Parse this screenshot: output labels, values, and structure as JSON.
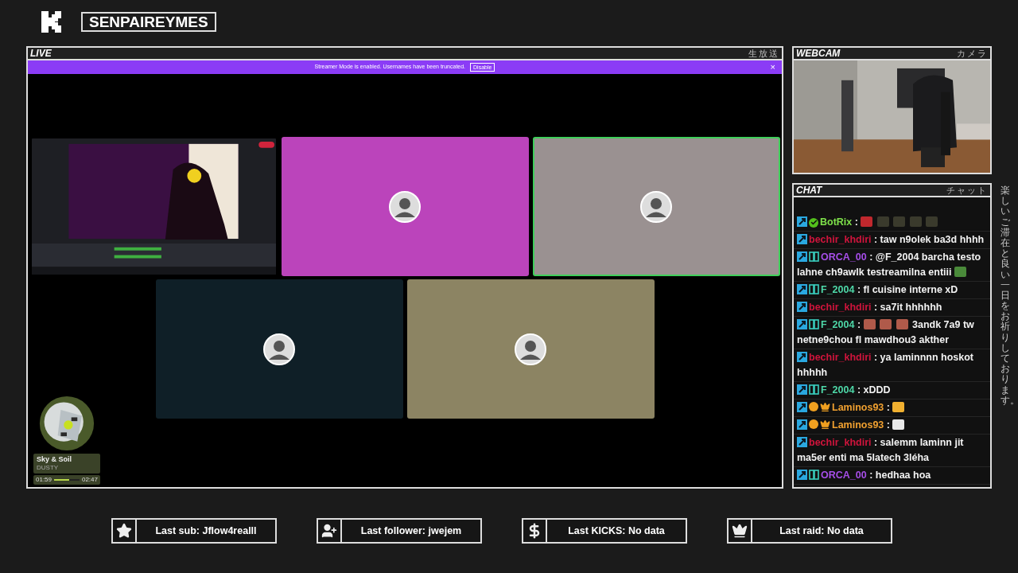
{
  "header": {
    "channel_name": "SENPAIREYMES"
  },
  "live": {
    "title": "LIVE",
    "subtitle": "生放送",
    "banner": {
      "text": "Streamer Mode is enabled. Usernames have been truncated.",
      "button": "Disable",
      "close": "×"
    },
    "tiles": [
      {
        "kind": "screen",
        "speaking": false
      },
      {
        "kind": "avatar",
        "color": "#bb44bb",
        "speaking": false
      },
      {
        "kind": "avatar",
        "color": "#9a9191",
        "speaking": true
      },
      {
        "kind": "avatar",
        "color": "#0f1f27",
        "speaking": false
      },
      {
        "kind": "avatar",
        "color": "#8c8463",
        "speaking": false
      }
    ],
    "music": {
      "title": "Sky & Soil",
      "artist": "DUSTY",
      "elapsed": "01:59",
      "total": "02:47",
      "level": 0.6
    }
  },
  "webcam": {
    "title": "WEBCAM",
    "subtitle": "カメラ"
  },
  "chat": {
    "title": "CHAT",
    "subtitle": "チャット",
    "messages": [
      {
        "user": "BotRix",
        "color": "#7ee04a",
        "badges": [
          {
            "kind": "kick"
          },
          {
            "kind": "verified"
          }
        ],
        "parts": [
          {
            "kind": "text",
            "text": ":"
          },
          {
            "kind": "emote",
            "color": "#c0282d"
          },
          {
            "kind": "emote",
            "color": "#3a3a2c"
          },
          {
            "kind": "emote",
            "color": "#3a3a2c"
          },
          {
            "kind": "emote",
            "color": "#3a3a2c"
          },
          {
            "kind": "emote",
            "color": "#3a3a2c"
          }
        ]
      },
      {
        "user": "bechir_khdiri",
        "color": "#d0143c",
        "badges": [
          {
            "kind": "kick"
          }
        ],
        "parts": [
          {
            "kind": "text",
            "text": ": taw n9olek ba3d hhhh"
          }
        ]
      },
      {
        "user": "ORCA_00",
        "color": "#a64ee8",
        "badges": [
          {
            "kind": "kick"
          },
          {
            "kind": "og"
          }
        ],
        "parts": [
          {
            "kind": "text",
            "text": ": @F_2004 barcha testo lahne ch9awlk testreamilna entiii"
          },
          {
            "kind": "emote",
            "color": "#4a8a3a"
          }
        ]
      },
      {
        "user": "F_2004",
        "color": "#4ed8a8",
        "badges": [
          {
            "kind": "kick"
          },
          {
            "kind": "og"
          }
        ],
        "parts": [
          {
            "kind": "text",
            "text": ": fl cuisine interne xD"
          }
        ]
      },
      {
        "user": "bechir_khdiri",
        "color": "#d0143c",
        "badges": [
          {
            "kind": "kick"
          }
        ],
        "parts": [
          {
            "kind": "text",
            "text": ": sa7it hhhhhh"
          }
        ]
      },
      {
        "user": "F_2004",
        "color": "#4ed8a8",
        "badges": [
          {
            "kind": "kick"
          },
          {
            "kind": "og"
          }
        ],
        "parts": [
          {
            "kind": "text",
            "text": ":"
          },
          {
            "kind": "emote",
            "color": "#b05a4a"
          },
          {
            "kind": "emote",
            "color": "#b05a4a"
          },
          {
            "kind": "emote",
            "color": "#b05a4a"
          },
          {
            "kind": "text",
            "text": "3andk 7a9 tw netne9chou fl mawdhou3 akther"
          }
        ]
      },
      {
        "user": "bechir_khdiri",
        "color": "#d0143c",
        "badges": [
          {
            "kind": "kick"
          }
        ],
        "parts": [
          {
            "kind": "text",
            "text": ": ya laminnnn hoskot hhhhh"
          }
        ]
      },
      {
        "user": "F_2004",
        "color": "#4ed8a8",
        "badges": [
          {
            "kind": "kick"
          },
          {
            "kind": "og"
          }
        ],
        "parts": [
          {
            "kind": "text",
            "text": ": xDDD"
          }
        ]
      },
      {
        "user": "Laminos93",
        "color": "#f0a030",
        "badges": [
          {
            "kind": "kick"
          },
          {
            "kind": "sub"
          },
          {
            "kind": "crown"
          }
        ],
        "parts": [
          {
            "kind": "text",
            "text": ":"
          },
          {
            "kind": "emote",
            "color": "#f0b030"
          }
        ]
      },
      {
        "user": "Laminos93",
        "color": "#f0a030",
        "badges": [
          {
            "kind": "kick"
          },
          {
            "kind": "sub"
          },
          {
            "kind": "crown"
          }
        ],
        "parts": [
          {
            "kind": "text",
            "text": ":"
          },
          {
            "kind": "emote",
            "color": "#e8e8e8"
          }
        ]
      },
      {
        "user": "bechir_khdiri",
        "color": "#d0143c",
        "badges": [
          {
            "kind": "kick"
          }
        ],
        "parts": [
          {
            "kind": "text",
            "text": ": salemm laminn jit ma5er enti ma 5latech 3léha"
          }
        ]
      },
      {
        "user": "ORCA_00",
        "color": "#a64ee8",
        "badges": [
          {
            "kind": "kick"
          },
          {
            "kind": "og"
          }
        ],
        "parts": [
          {
            "kind": "text",
            "text": ": hedhaa hoa"
          }
        ]
      }
    ]
  },
  "side_text": "楽しいご滞在と良い一日をお祈りしております。",
  "stats": [
    {
      "kind": "star",
      "text": "Last sub: Jflow4realll"
    },
    {
      "kind": "follower",
      "text": "Last follower: jwejem"
    },
    {
      "kind": "dollar",
      "text": "Last KICKS: No data"
    },
    {
      "kind": "crown",
      "text": "Last raid: No data"
    }
  ]
}
